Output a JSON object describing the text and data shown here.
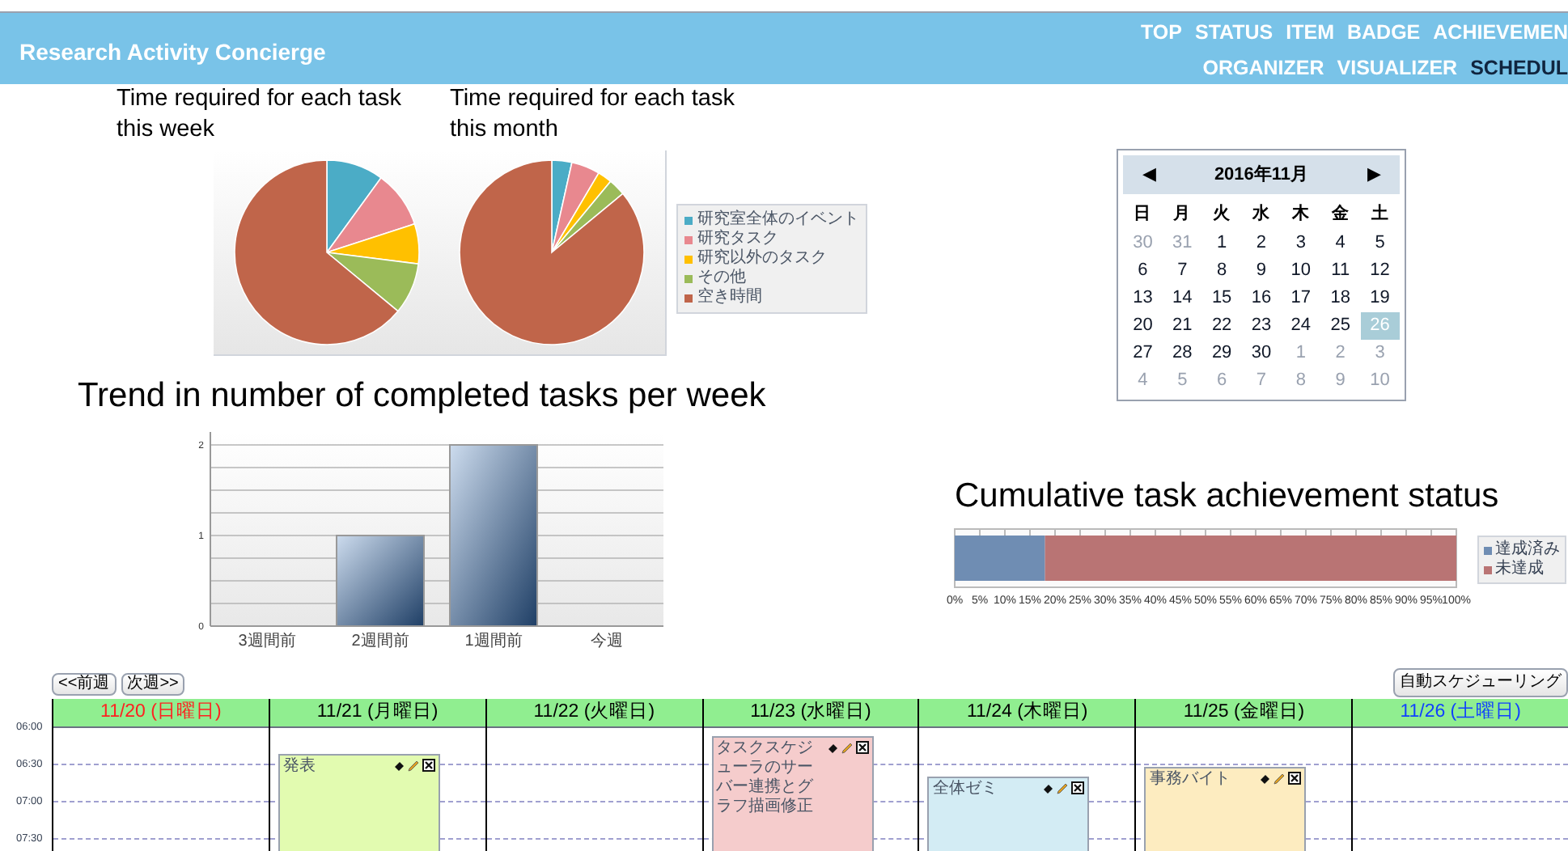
{
  "header": {
    "title": "Research Activity Concierge",
    "nav": [
      [
        {
          "label": "TOP",
          "selected": false
        },
        {
          "label": "STATUS",
          "selected": false
        },
        {
          "label": "ITEM",
          "selected": false
        },
        {
          "label": "BADGE",
          "selected": false
        },
        {
          "label": "ACHIEVEMEN",
          "selected": false
        }
      ],
      [
        {
          "label": "ORGANIZER",
          "selected": false
        },
        {
          "label": "VISUALIZER",
          "selected": false
        },
        {
          "label": "SCHEDUL",
          "selected": true
        }
      ]
    ]
  },
  "time_charts": {
    "titles": [
      "Time required for each task this week",
      "Time required for each task this month"
    ],
    "legend": [
      {
        "label": "研究室全体のイベント",
        "color": "#4bacc6"
      },
      {
        "label": "研究タスク",
        "color": "#e8888f"
      },
      {
        "label": "研究以外のタスク",
        "color": "#ffc000"
      },
      {
        "label": "その他",
        "color": "#9bbb59"
      },
      {
        "label": "空き時間",
        "color": "#c0654a"
      }
    ]
  },
  "trend": {
    "title": "Trend in number of completed tasks per week",
    "chart_data": {
      "type": "bar",
      "categories": [
        "3週間前",
        "2週間前",
        "1週間前",
        "今週"
      ],
      "values": [
        0,
        1,
        2,
        0
      ],
      "ylim": [
        0,
        2
      ],
      "yticks": [
        0,
        1,
        2
      ]
    }
  },
  "calendar": {
    "title": "2016年11月",
    "prev": "◀",
    "next": "▶",
    "weekdays": [
      "日",
      "月",
      "火",
      "水",
      "木",
      "金",
      "土"
    ],
    "days": [
      {
        "label": "30",
        "muted": true,
        "selected": false
      },
      {
        "label": "31",
        "muted": true,
        "selected": false
      },
      {
        "label": "1",
        "muted": false,
        "selected": false
      },
      {
        "label": "2",
        "muted": false,
        "selected": false
      },
      {
        "label": "3",
        "muted": false,
        "selected": false
      },
      {
        "label": "4",
        "muted": false,
        "selected": false
      },
      {
        "label": "5",
        "muted": false,
        "selected": false
      },
      {
        "label": "6",
        "muted": false,
        "selected": false
      },
      {
        "label": "7",
        "muted": false,
        "selected": false
      },
      {
        "label": "8",
        "muted": false,
        "selected": false
      },
      {
        "label": "9",
        "muted": false,
        "selected": false
      },
      {
        "label": "10",
        "muted": false,
        "selected": false
      },
      {
        "label": "11",
        "muted": false,
        "selected": false
      },
      {
        "label": "12",
        "muted": false,
        "selected": false
      },
      {
        "label": "13",
        "muted": false,
        "selected": false
      },
      {
        "label": "14",
        "muted": false,
        "selected": false
      },
      {
        "label": "15",
        "muted": false,
        "selected": false
      },
      {
        "label": "16",
        "muted": false,
        "selected": false
      },
      {
        "label": "17",
        "muted": false,
        "selected": false
      },
      {
        "label": "18",
        "muted": false,
        "selected": false
      },
      {
        "label": "19",
        "muted": false,
        "selected": false
      },
      {
        "label": "20",
        "muted": false,
        "selected": false
      },
      {
        "label": "21",
        "muted": false,
        "selected": false
      },
      {
        "label": "22",
        "muted": false,
        "selected": false
      },
      {
        "label": "23",
        "muted": false,
        "selected": false
      },
      {
        "label": "24",
        "muted": false,
        "selected": false
      },
      {
        "label": "25",
        "muted": false,
        "selected": false
      },
      {
        "label": "26",
        "muted": false,
        "selected": true
      },
      {
        "label": "27",
        "muted": false,
        "selected": false
      },
      {
        "label": "28",
        "muted": false,
        "selected": false
      },
      {
        "label": "29",
        "muted": false,
        "selected": false
      },
      {
        "label": "30",
        "muted": false,
        "selected": false
      },
      {
        "label": "1",
        "muted": true,
        "selected": false
      },
      {
        "label": "2",
        "muted": true,
        "selected": false
      },
      {
        "label": "3",
        "muted": true,
        "selected": false
      },
      {
        "label": "4",
        "muted": true,
        "selected": false
      },
      {
        "label": "5",
        "muted": true,
        "selected": false
      },
      {
        "label": "6",
        "muted": true,
        "selected": false
      },
      {
        "label": "7",
        "muted": true,
        "selected": false
      },
      {
        "label": "8",
        "muted": true,
        "selected": false
      },
      {
        "label": "9",
        "muted": true,
        "selected": false
      },
      {
        "label": "10",
        "muted": true,
        "selected": false
      }
    ]
  },
  "achievement": {
    "title": "Cumulative task achievement status",
    "chart_data": {
      "type": "bar",
      "orientation": "horizontal",
      "stacked": true,
      "xlim": [
        0,
        100
      ],
      "categories": [
        null
      ],
      "series": [
        {
          "name": "達成済み",
          "color": "#6f8db3",
          "values": [
            18
          ]
        },
        {
          "name": "未達成",
          "color": "#b97474",
          "values": [
            82
          ]
        }
      ],
      "xticks": [
        {
          "value": 0,
          "label": "0%"
        },
        {
          "value": 5,
          "label": "5%"
        },
        {
          "value": 10,
          "label": "10%"
        },
        {
          "value": 15,
          "label": "15%"
        },
        {
          "value": 20,
          "label": "20%"
        },
        {
          "value": 25,
          "label": "25%"
        },
        {
          "value": 30,
          "label": "30%"
        },
        {
          "value": 35,
          "label": "35%"
        },
        {
          "value": 40,
          "label": "40%"
        },
        {
          "value": 45,
          "label": "45%"
        },
        {
          "value": 50,
          "label": "50%"
        },
        {
          "value": 55,
          "label": "55%"
        },
        {
          "value": 60,
          "label": "60%"
        },
        {
          "value": 65,
          "label": "65%"
        },
        {
          "value": 70,
          "label": "70%"
        },
        {
          "value": 75,
          "label": "75%"
        },
        {
          "value": 80,
          "label": "80%"
        },
        {
          "value": 85,
          "label": "85%"
        },
        {
          "value": 90,
          "label": "90%"
        },
        {
          "value": 95,
          "label": "95%"
        },
        {
          "value": 100,
          "label": "100%"
        }
      ]
    }
  },
  "schedule": {
    "prev_button": "<<前週",
    "next_button": "次週>>",
    "auto_button": "自動スケジューリング",
    "times": [
      "06:00",
      "06:30",
      "07:00",
      "07:30"
    ],
    "days": [
      {
        "label": "11/20 (日曜日)",
        "kind": "sunday"
      },
      {
        "label": "11/21 (月曜日)",
        "kind": "weekday",
        "events": [
          {
            "title": "発表",
            "color": "#e2fbb0"
          }
        ]
      },
      {
        "label": "11/22 (火曜日)",
        "kind": "weekday"
      },
      {
        "label": "11/23 (水曜日)",
        "kind": "weekday",
        "events": [
          {
            "title": "タスクスケジューラのサーバー連携とグラフ描画修正",
            "color": "#f5cccc"
          }
        ]
      },
      {
        "label": "11/24 (木曜日)",
        "kind": "weekday",
        "events": [
          {
            "title": "全体ゼミ",
            "color": "#d3ecf4"
          }
        ]
      },
      {
        "label": "11/25 (金曜日)",
        "kind": "weekday",
        "events": [
          {
            "title": "事務バイト",
            "color": "#fdecc0"
          }
        ]
      },
      {
        "label": "11/26 (土曜日)",
        "kind": "saturday"
      }
    ]
  }
}
